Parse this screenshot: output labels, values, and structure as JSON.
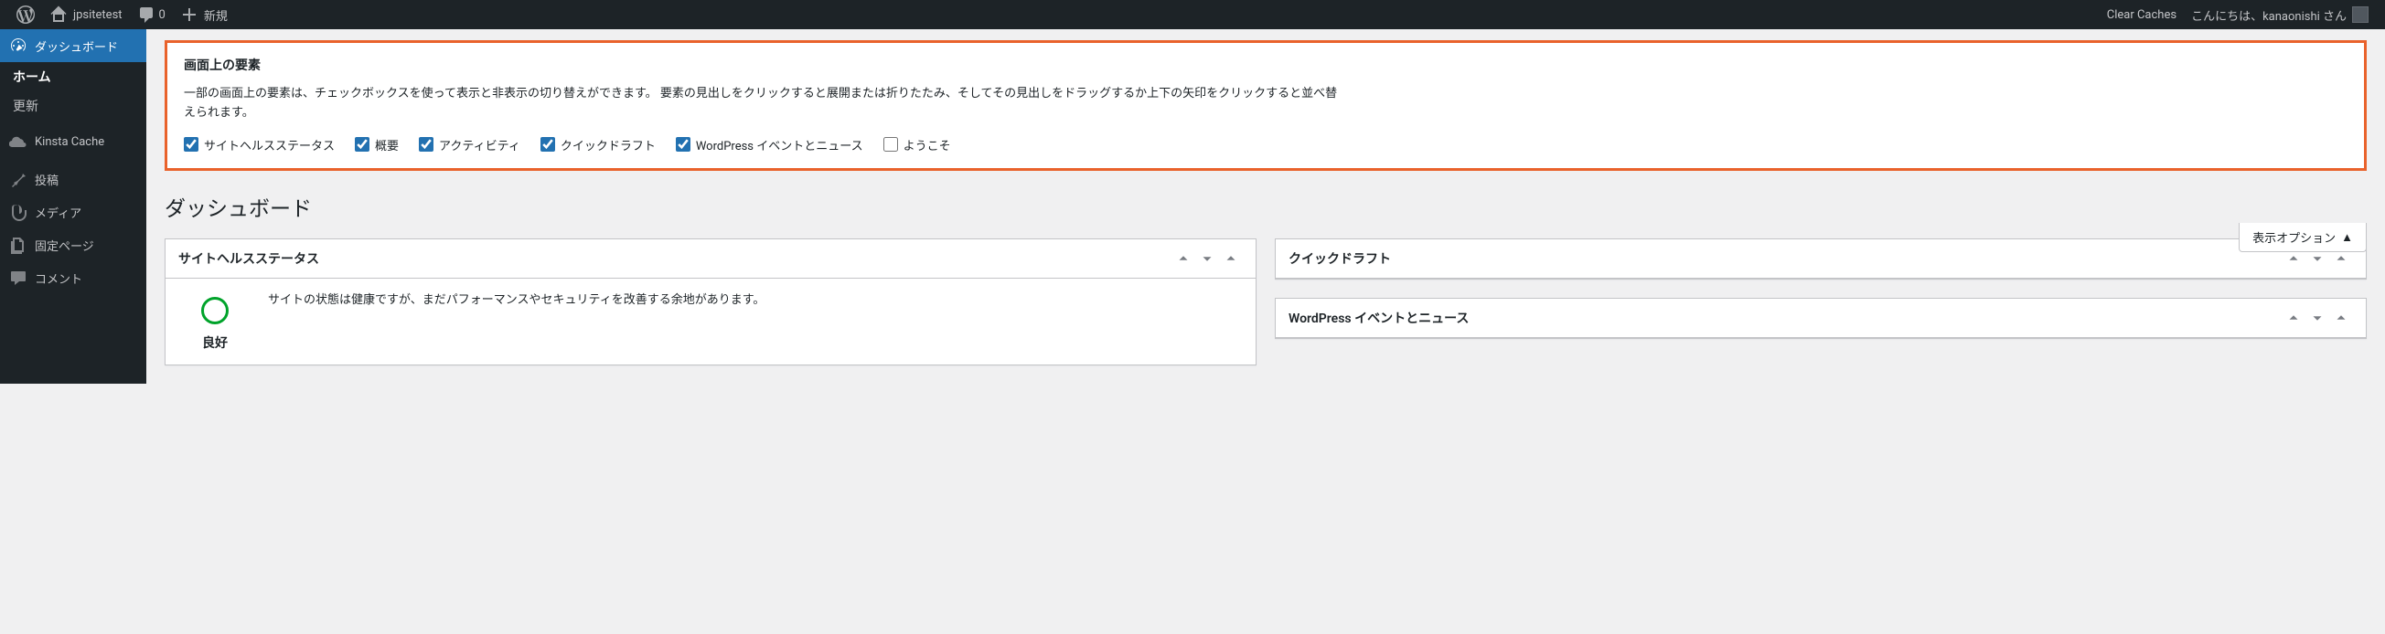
{
  "adminbar": {
    "site_name": "jpsitetest",
    "comments_count": "0",
    "new_label": "新規",
    "clear_caches": "Clear Caches",
    "greeting": "こんにちは、kanaonishi さん"
  },
  "menu": {
    "dashboard": "ダッシュボード",
    "home": "ホーム",
    "updates": "更新",
    "kinsta": "Kinsta Cache",
    "posts": "投稿",
    "media": "メディア",
    "pages": "固定ページ",
    "comments": "コメント"
  },
  "screen_options": {
    "title": "画面上の要素",
    "description": "一部の画面上の要素は、チェックボックスを使って表示と非表示の切り替えができます。 要素の見出しをクリックすると展開または折りたたみ、そしてその見出しをドラッグするか上下の矢印をクリックすると並べ替えられます。",
    "options": [
      {
        "label": "サイトヘルスステータス",
        "checked": true
      },
      {
        "label": "概要",
        "checked": true
      },
      {
        "label": "アクティビティ",
        "checked": true
      },
      {
        "label": "クイックドラフト",
        "checked": true
      },
      {
        "label": "WordPress イベントとニュース",
        "checked": true
      },
      {
        "label": "ようこそ",
        "checked": false
      }
    ],
    "tab_label": "表示オプション"
  },
  "page": {
    "title": "ダッシュボード"
  },
  "widgets": {
    "site_health": {
      "title": "サイトヘルスステータス",
      "status": "良好",
      "text": "サイトの状態は健康ですが、まだパフォーマンスやセキュリティを改善する余地があります。"
    },
    "quick_draft": {
      "title": "クイックドラフト"
    },
    "events": {
      "title": "WordPress イベントとニュース"
    }
  }
}
